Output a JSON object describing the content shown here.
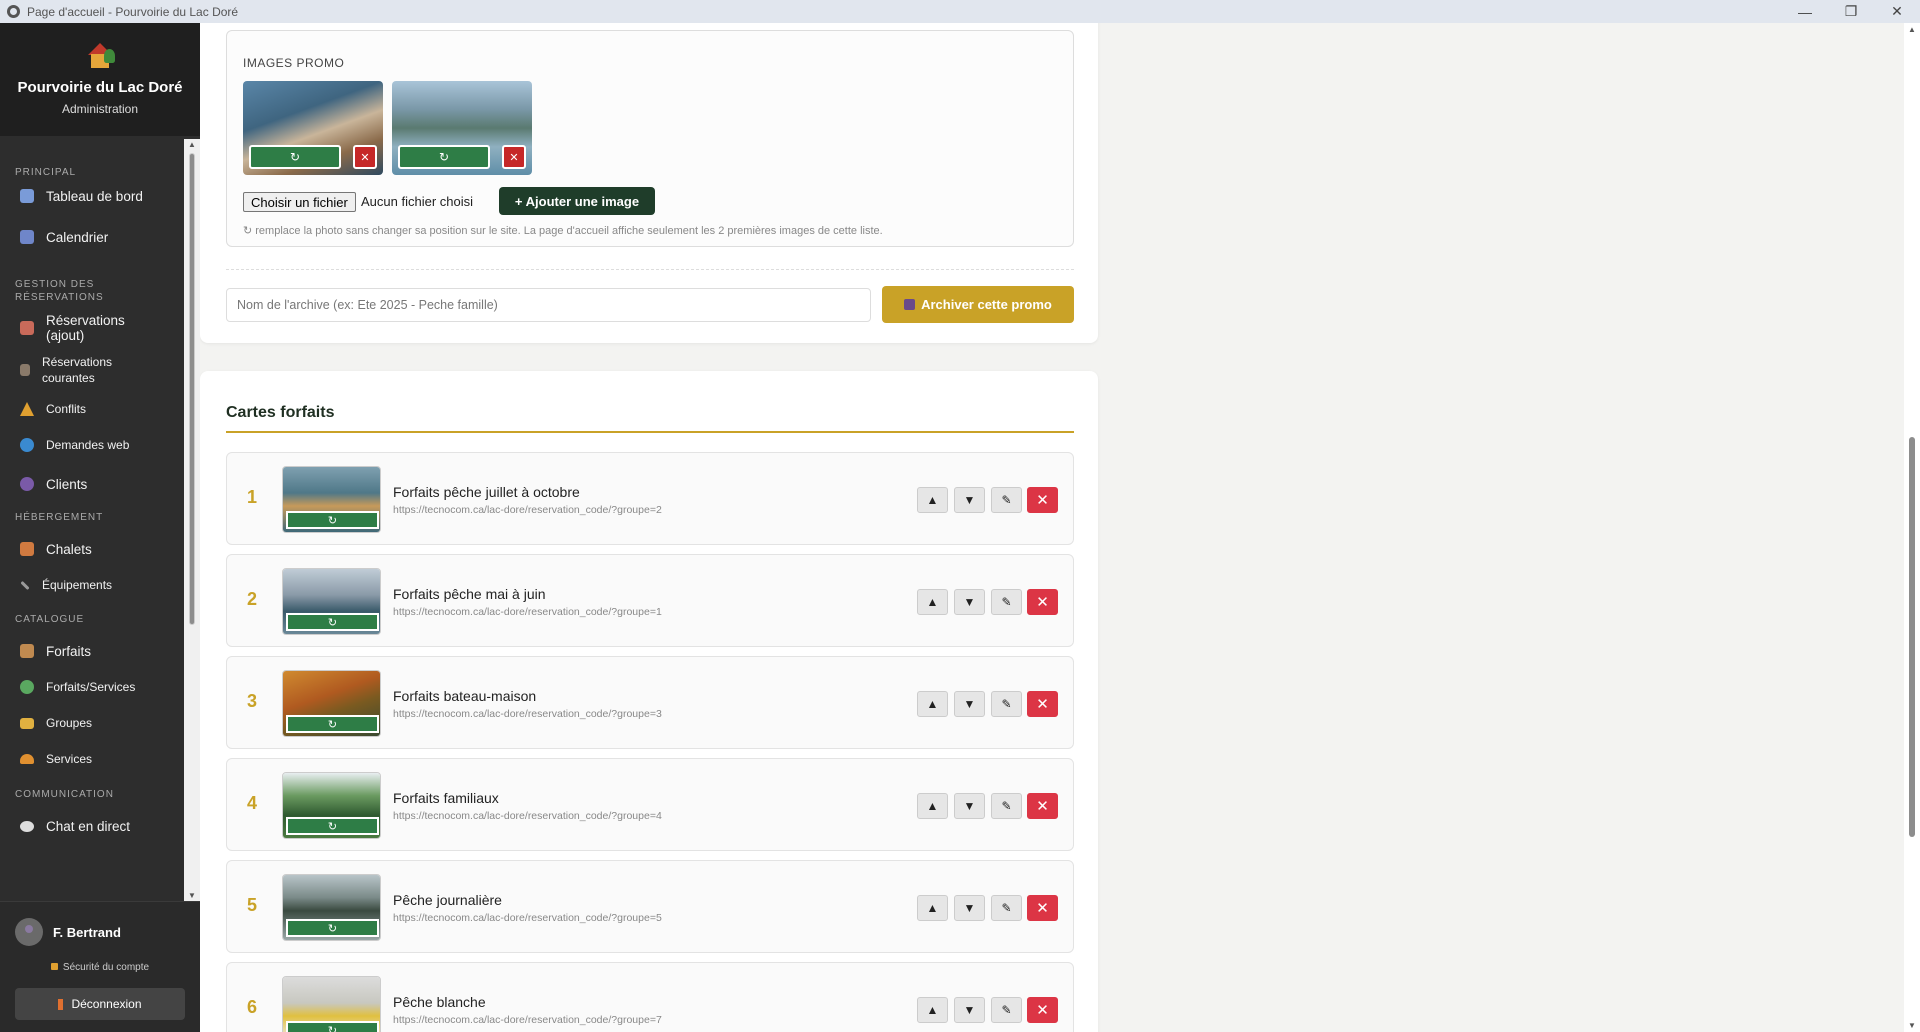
{
  "window": {
    "title": "Page d'accueil - Pourvoirie du Lac Doré",
    "minimize": "—",
    "restore": "❐",
    "close": "✕"
  },
  "brand": {
    "name": "Pourvoirie du Lac Doré",
    "subtitle": "Administration"
  },
  "sidebar": {
    "sections": [
      {
        "label": "PRINCIPAL"
      },
      {
        "label": "GESTION DES RÉSERVATIONS"
      },
      {
        "label": "HÉBERGEMENT"
      },
      {
        "label": "CATALOGUE"
      },
      {
        "label": "COMMUNICATION"
      }
    ],
    "items": [
      {
        "label": "Tableau de bord",
        "icon": "chart-icon",
        "color": "#7a9bd8"
      },
      {
        "label": "Calendrier",
        "icon": "calendar-icon",
        "color": "#6f86c9"
      },
      {
        "label": "Réservations (ajout)",
        "icon": "booking-add-icon",
        "color": "#c96a5a"
      },
      {
        "label": "Réservations courantes",
        "icon": "booking-list-icon",
        "color": "#8a7a6a"
      },
      {
        "label": "Conflits",
        "icon": "warning-icon",
        "color": "#e0a030"
      },
      {
        "label": "Demandes web",
        "icon": "globe-icon",
        "color": "#3a8ad0"
      },
      {
        "label": "Clients",
        "icon": "users-icon",
        "color": "#7a5aa8"
      },
      {
        "label": "Chalets",
        "icon": "house-icon",
        "color": "#d07a40"
      },
      {
        "label": "Équipements",
        "icon": "wrench-icon",
        "color": "#999999"
      },
      {
        "label": "Forfaits",
        "icon": "package-icon",
        "color": "#c08a50"
      },
      {
        "label": "Forfaits/Services",
        "icon": "puzzle-icon",
        "color": "#5aa860"
      },
      {
        "label": "Groupes",
        "icon": "folder-icon",
        "color": "#e0b040"
      },
      {
        "label": "Services",
        "icon": "bell-icon",
        "color": "#e09030"
      },
      {
        "label": "Chat en direct",
        "icon": "chat-icon",
        "color": "#dddddd"
      }
    ]
  },
  "user": {
    "name": "F. Bertrand",
    "security": "Sécurité du compte",
    "logout": "Déconnexion"
  },
  "promo": {
    "label": "IMAGES PROMO",
    "replace_symbol": "↻",
    "delete_symbol": "✕",
    "file_button": "Choisir un fichier",
    "file_none": "Aucun fichier choisi",
    "add_image": "+ Ajouter une image",
    "hint": "↻ remplace la photo sans changer sa position sur le site. La page d'accueil affiche seulement les 2 premières images de cette liste.",
    "archive_placeholder": "Nom de l'archive (ex: Ete 2025 - Peche famille)",
    "archive_button": "Archiver cette promo"
  },
  "forfaits": {
    "title": "Cartes forfaits",
    "up_symbol": "▲",
    "down_symbol": "▼",
    "edit_symbol": "✎",
    "delete_symbol": "✕",
    "replace_symbol": "↻",
    "rows": [
      {
        "num": "1",
        "title": "Forfaits pêche juillet à octobre",
        "url": "https://tecnocom.ca/lac-dore/reservation_code/?groupe=2"
      },
      {
        "num": "2",
        "title": "Forfaits pêche mai à juin",
        "url": "https://tecnocom.ca/lac-dore/reservation_code/?groupe=1"
      },
      {
        "num": "3",
        "title": "Forfaits bateau-maison",
        "url": "https://tecnocom.ca/lac-dore/reservation_code/?groupe=3"
      },
      {
        "num": "4",
        "title": "Forfaits familiaux",
        "url": "https://tecnocom.ca/lac-dore/reservation_code/?groupe=4"
      },
      {
        "num": "5",
        "title": "Pêche journalière",
        "url": "https://tecnocom.ca/lac-dore/reservation_code/?groupe=5"
      },
      {
        "num": "6",
        "title": "Pêche blanche",
        "url": "https://tecnocom.ca/lac-dore/reservation_code/?groupe=7"
      }
    ]
  }
}
